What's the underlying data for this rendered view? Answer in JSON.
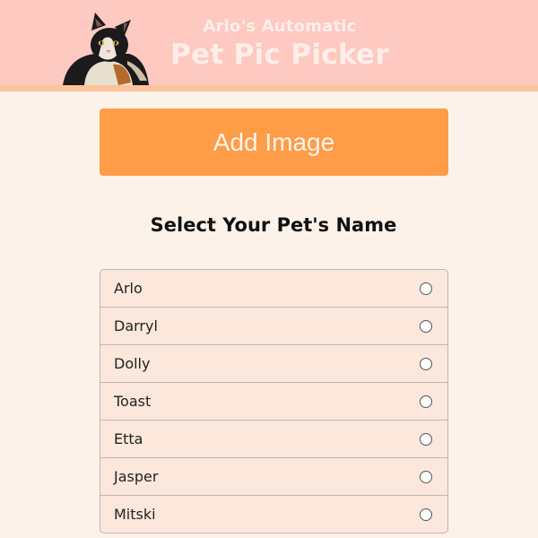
{
  "header": {
    "subtitle": "Arlo's Automatic",
    "title": "Pet Pic Picker",
    "background": "#fec9c1",
    "stripe": "#fcc49a"
  },
  "add_button": {
    "label": "Add Image",
    "color": "#fe9c47"
  },
  "select_heading": "Select Your Pet's Name",
  "pets": [
    {
      "name": "Arlo",
      "selected": false
    },
    {
      "name": "Darryl",
      "selected": false
    },
    {
      "name": "Dolly",
      "selected": false
    },
    {
      "name": "Toast",
      "selected": false
    },
    {
      "name": "Etta",
      "selected": false
    },
    {
      "name": "Jasper",
      "selected": false
    },
    {
      "name": "Mitski",
      "selected": false
    }
  ]
}
